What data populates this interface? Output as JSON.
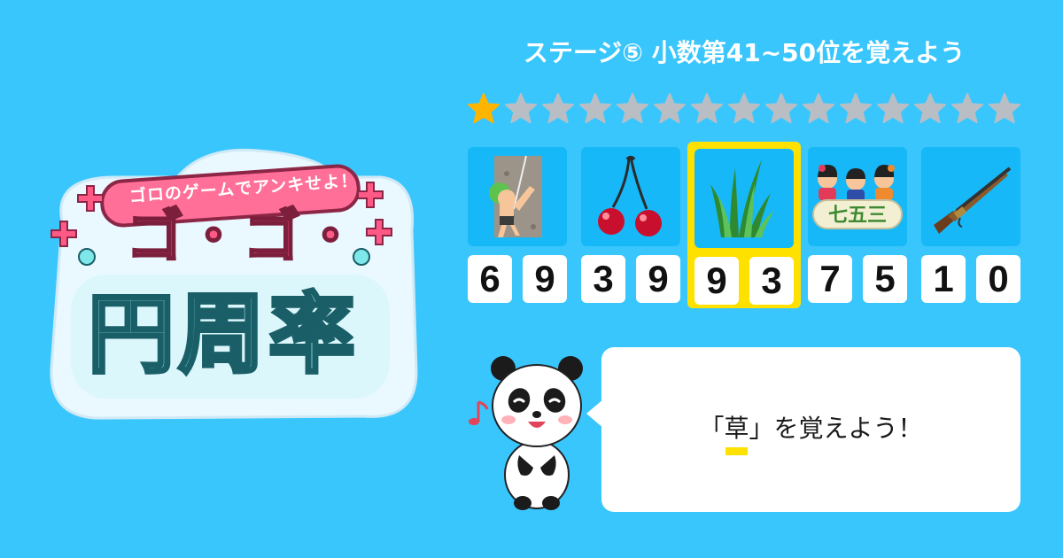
{
  "logo": {
    "subtitle": "ゴロのゲームでアンキせよ！",
    "title": "ゴ・ゴ・",
    "name": "円周率"
  },
  "stage": {
    "title": "ステージ⑤  小数第41~50位を覚えよう"
  },
  "progress": {
    "stars_filled": 1,
    "stars_total": 15,
    "filled_color": "#ffb400",
    "empty_color": "#b9bec4"
  },
  "cards": [
    {
      "image": "rock-climber-icon",
      "digits": [
        "6",
        "9"
      ],
      "selected": false
    },
    {
      "image": "cherries-icon",
      "digits": [
        "3",
        "9"
      ],
      "selected": false
    },
    {
      "image": "grass-icon",
      "digits": [
        "9",
        "3"
      ],
      "selected": true
    },
    {
      "image": "shichigosan-children-icon",
      "digits": [
        "7",
        "5"
      ],
      "selected": false
    },
    {
      "image": "matchlock-gun-icon",
      "digits": [
        "1",
        "0"
      ],
      "selected": false
    }
  ],
  "card5_label": "七五三",
  "mascot": {
    "image": "panda-icon",
    "note_icon": "music-note-icon"
  },
  "speech": {
    "open": "「",
    "keyword": "草",
    "close": "」を覚えよう！"
  },
  "colors": {
    "background": "#39c6fd",
    "highlight": "#ffe100"
  }
}
